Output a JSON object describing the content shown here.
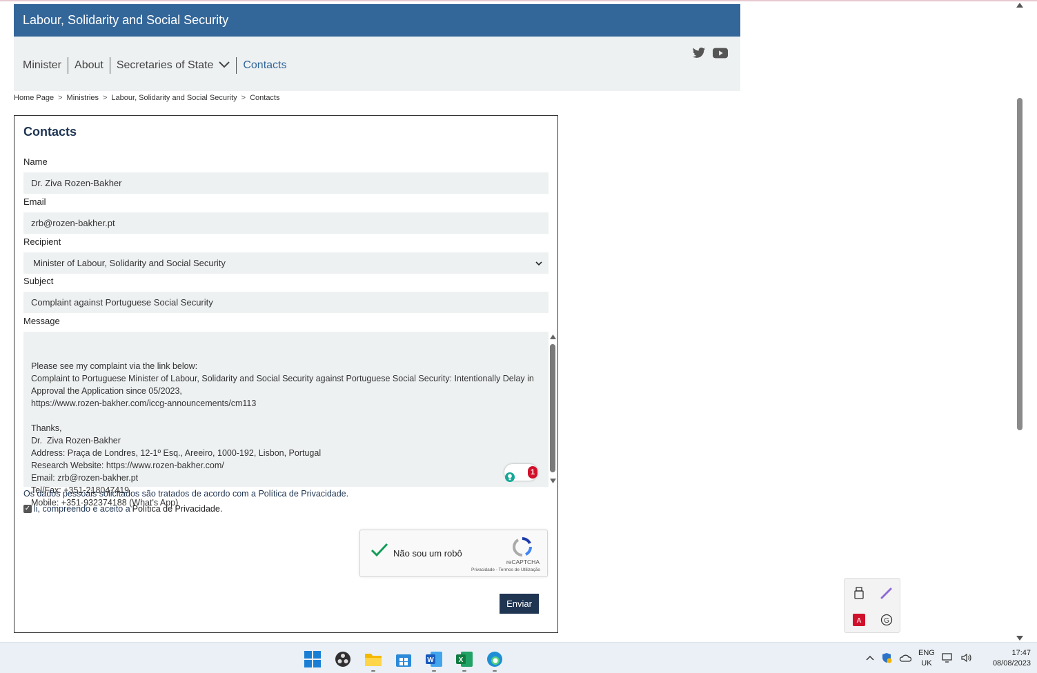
{
  "header": {
    "title": "Labour, Solidarity and Social Security"
  },
  "nav": {
    "items": [
      "Minister",
      "About",
      "Secretaries of State",
      "Contacts"
    ]
  },
  "social": {
    "icons": [
      "twitter-icon",
      "youtube-icon"
    ]
  },
  "breadcrumb": {
    "items": [
      "Home Page",
      "Ministries",
      "Labour, Solidarity and Social Security",
      "Contacts"
    ],
    "separator": ">"
  },
  "form": {
    "title": "Contacts",
    "name_label": "Name",
    "name_value": "Dr. Ziva Rozen-Bakher",
    "email_label": "Email",
    "email_value": "zrb@rozen-bakher.pt",
    "recipient_label": "Recipient",
    "recipient_value": "Minister of Labour, Solidarity and Social Security",
    "subject_label": "Subject",
    "subject_value": "Complaint against Portuguese Social Security",
    "message_label": "Message",
    "message_value": "Please see my complaint via the link below:\nComplaint to Portuguese Minister of Labour, Solidarity and Social Security against Portuguese Social Security: Intentionally Delay in Approval the Application since 05/2023,\nhttps://www.rozen-bakher.com/iccg-announcements/cm113\n\nThanks,\nDr.  Ziva Rozen-Bakher\nAddress: Praça de Londres, 12-1º Esq., Areeiro, 1000-192, Lisbon, Portugal\nResearch Website: https://www.rozen-bakher.com/\nEmail: zrb@rozen-bakher.pt\nTel/Fax: +351-218047419\nMobile: +351-932374188 (What's App)",
    "grammarly_count": "1",
    "privacy_text": "Os dados pessoais solicitados são tratados de acordo com a ",
    "privacy_link": "Política de Privacidade.",
    "consent_text": "li, compreendo e aceito a ",
    "consent_link": "Política de Privacidade.",
    "consent_checked": true,
    "recaptcha_label": "Não sou um robô",
    "recaptcha_brand": "reCAPTCHA",
    "recaptcha_links": "Privacidade - Termos de Utilização",
    "submit_label": "Enviar"
  },
  "tray_popup": {
    "icons": [
      "usb-icon",
      "pen-icon",
      "adobe-icon",
      "grammarly-icon"
    ]
  },
  "taskbar": {
    "apps": [
      "windows-start-icon",
      "obs-icon",
      "file-explorer-icon",
      "store-icon",
      "word-icon",
      "excel-icon",
      "edge-icon"
    ],
    "lang_top": "ENG",
    "lang_bottom": "UK",
    "time": "17:47",
    "date": "08/08/2023"
  }
}
